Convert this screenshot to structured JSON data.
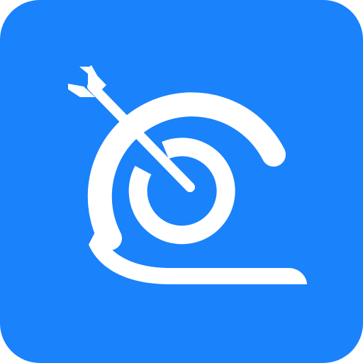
{
  "app_icon": {
    "icon": "target-arrow-spiral-icon",
    "colors": {
      "background": "#1a82fb",
      "foreground": "#ffffff"
    }
  }
}
